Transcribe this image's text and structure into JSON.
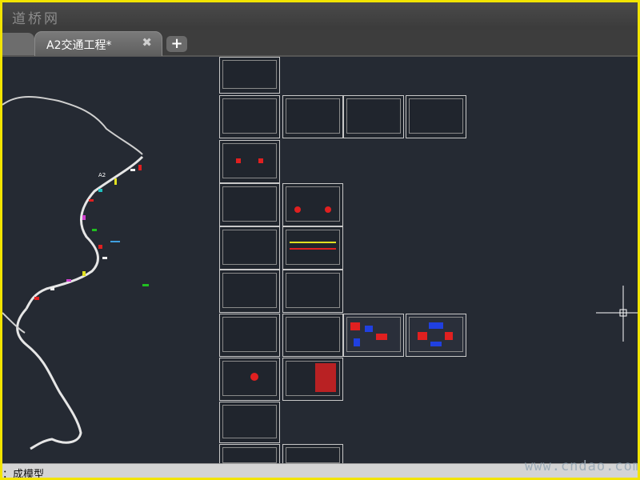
{
  "watermark_top": "道桥网",
  "tabs": [
    {
      "label": "A2交通工程*",
      "active": true
    }
  ],
  "new_tab_symbol": "+",
  "close_symbol": "✖",
  "status_text": "：成模型",
  "watermark_bottom": "www.cndao.com",
  "map_labels": {
    "route": "A2"
  },
  "colors": {
    "frame": "#f2e400",
    "canvas": "#252a33",
    "route_line": "#e6e6e6",
    "accent_red": "#e02020",
    "accent_blue": "#2040e0",
    "accent_cyan": "#20c0c0"
  }
}
